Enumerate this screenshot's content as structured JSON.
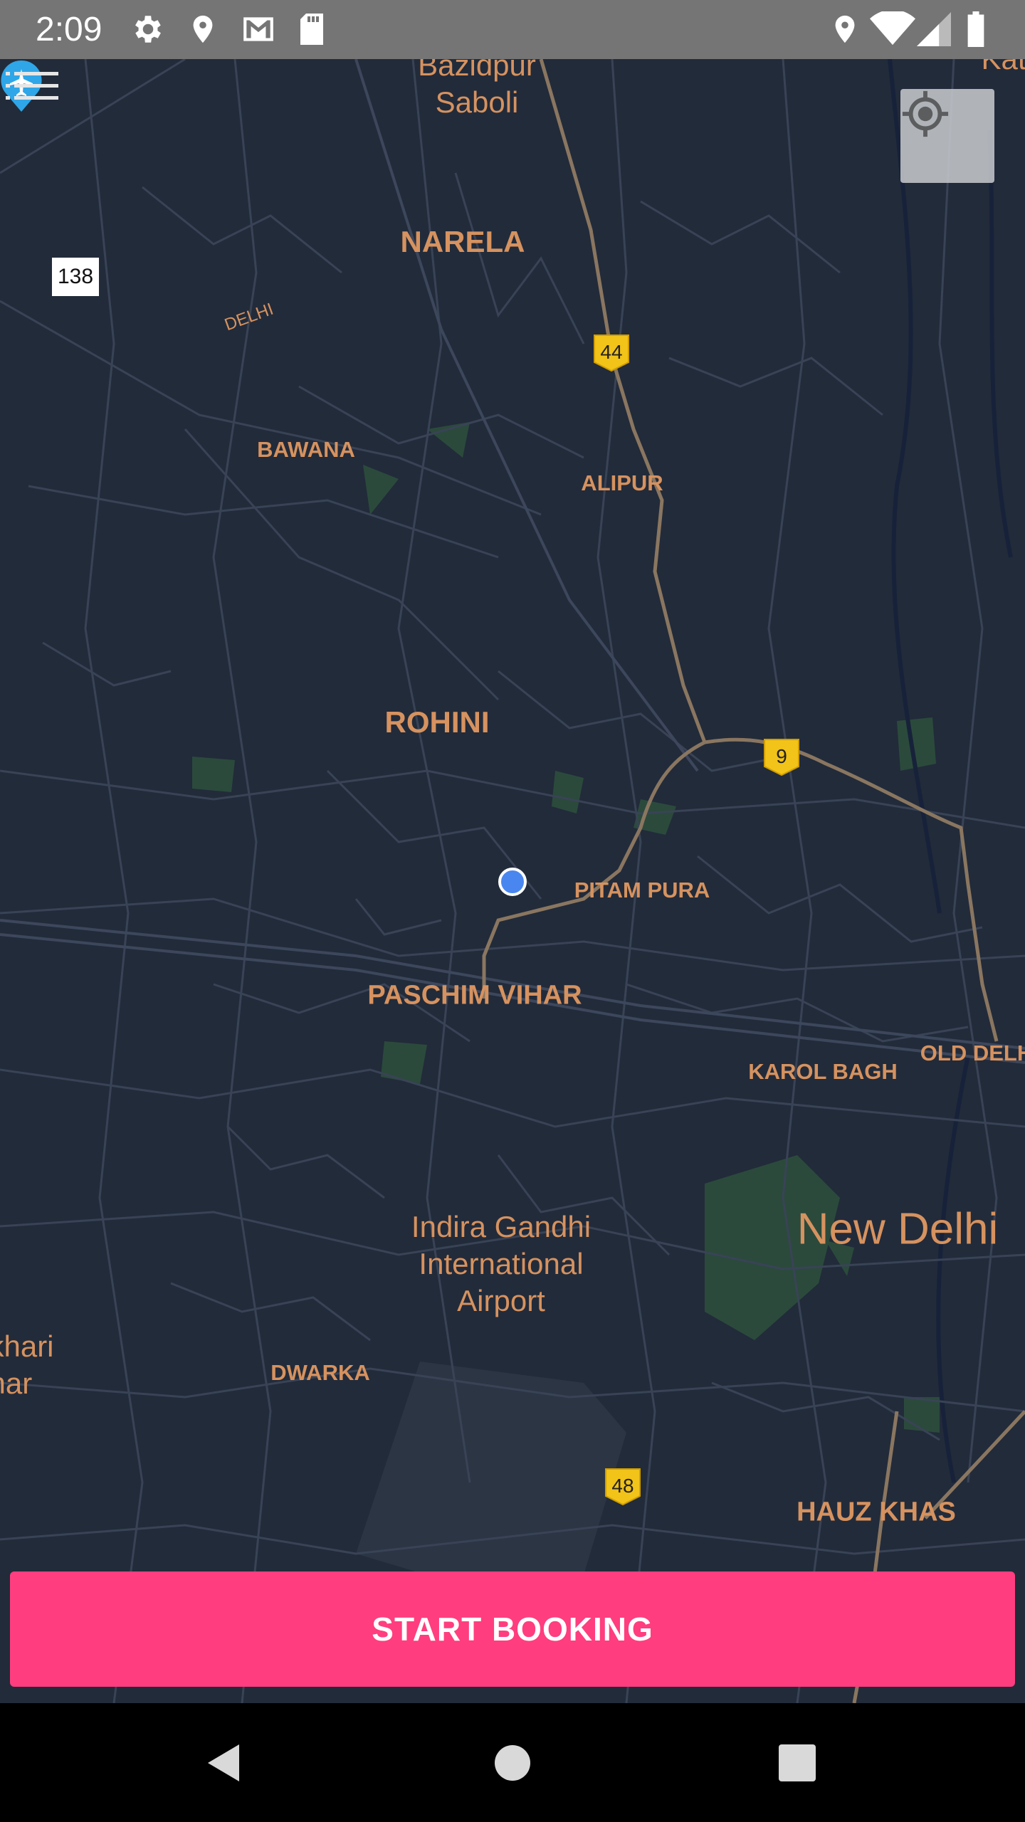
{
  "status_bar": {
    "time": "2:09",
    "left_icons": [
      "gear-icon",
      "location-pin-icon",
      "gmail-icon",
      "sd-card-icon"
    ],
    "right_icons": [
      "location-pin-icon",
      "wifi-icon",
      "cell-signal-icon",
      "battery-icon"
    ]
  },
  "map": {
    "labels": {
      "bazidpur_saboli": "Bazidpur\nSaboli",
      "narela": "NARELA",
      "delhi_small": "DELHI",
      "bawana": "BAWANA",
      "alipur": "ALIPUR",
      "rohini": "ROHINI",
      "pitam_pura": "PITAM PURA",
      "paschim_vihar": "PASCHIM VIHAR",
      "karol_bagh": "KAROL BAGH",
      "old_delhi": "OLD DELH",
      "new_delhi": "New Delhi",
      "airport": "Indira Gandhi\nInternational\nAirport",
      "dwarka": "DWARKA",
      "khari": "khari\nhar",
      "hauz_khas": "HAUZ KHAS",
      "top_right_partial": "Kat"
    },
    "highway_shields": [
      "44",
      "9",
      "48"
    ],
    "route_badge": "138"
  },
  "controls": {
    "menu_icon": "menu-list-icon",
    "locate_icon": "my-location-icon",
    "airport_icon": "airplane-pin-icon"
  },
  "booking": {
    "label": "START BOOKING"
  },
  "nav_bar": {
    "icons": [
      "back-icon",
      "home-icon",
      "recents-icon"
    ]
  },
  "colors": {
    "map_background": "#222b3a",
    "label": "#d6925f",
    "accent": "#ff3d7f",
    "user_location": "#4a86f0"
  }
}
